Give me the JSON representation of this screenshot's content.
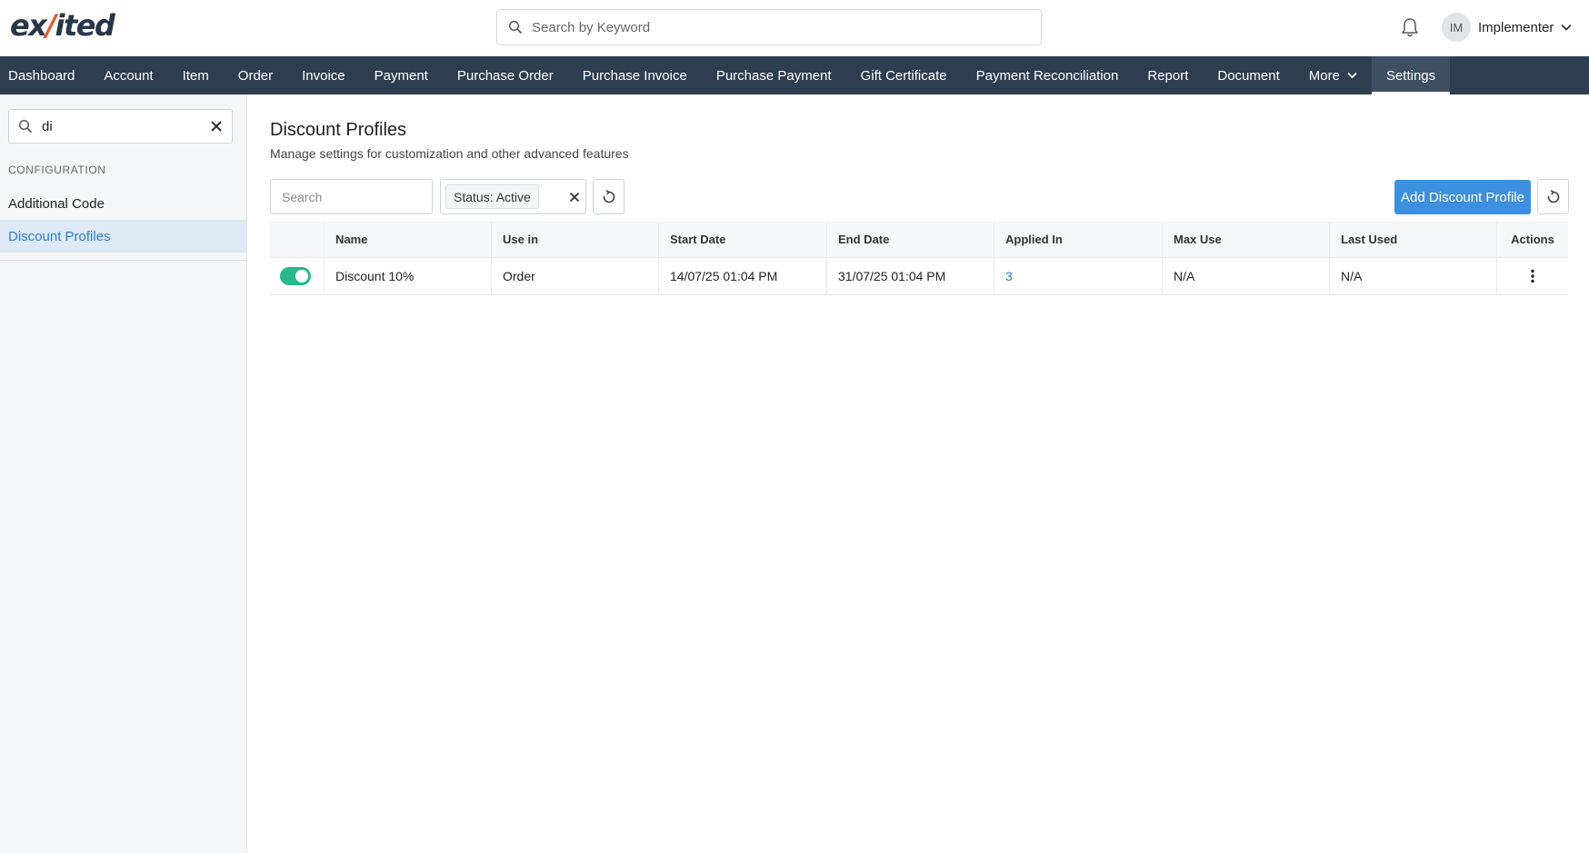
{
  "header": {
    "logo_prefix": "ex",
    "logo_accent": "/",
    "logo_suffix": "ited",
    "search_placeholder": "Search by Keyword",
    "user_initials": "IM",
    "user_name": "Implementer"
  },
  "nav": {
    "items": [
      "Dashboard",
      "Account",
      "Item",
      "Order",
      "Invoice",
      "Payment",
      "Purchase Order",
      "Purchase Invoice",
      "Purchase Payment",
      "Gift Certificate",
      "Payment Reconciliation",
      "Report",
      "Document"
    ],
    "more_label": "More",
    "settings_label": "Settings"
  },
  "sidebar": {
    "search_value": "di",
    "section_label": "CONFIGURATION",
    "items": [
      {
        "label": "Additional Code"
      },
      {
        "label": "Discount Profiles"
      }
    ]
  },
  "page": {
    "title": "Discount Profiles",
    "subtitle": "Manage settings for customization and other advanced features"
  },
  "toolbar": {
    "search_placeholder": "Search",
    "filter_chip": "Status: Active",
    "add_label": "Add Discount Profile"
  },
  "table": {
    "columns": [
      "Name",
      "Use in",
      "Start Date",
      "End Date",
      "Applied In",
      "Max Use",
      "Last Used",
      "Actions"
    ],
    "rows": [
      {
        "active": true,
        "name": "Discount 10%",
        "use_in": "Order",
        "start_date": "14/07/25 01:04 PM",
        "end_date": "31/07/25 01:04 PM",
        "applied_in": "3",
        "max_use": "N/A",
        "last_used": "N/A"
      }
    ]
  },
  "colors": {
    "nav_bg": "#2d3e50",
    "primary": "#3d8fe0",
    "toggle_on": "#27b98b",
    "link": "#2b7cd3",
    "logo_accent": "#e8582a"
  }
}
